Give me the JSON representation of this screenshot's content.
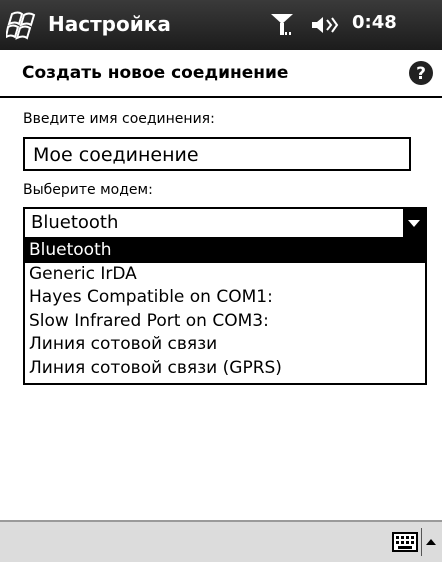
{
  "titlebar": {
    "app_title": "Настройка",
    "clock": "0:48",
    "icons": [
      "start-logo-icon",
      "signal-icon",
      "volume-icon"
    ]
  },
  "header": {
    "title": "Создать новое соединение",
    "help_icon": "help-icon"
  },
  "form": {
    "name_label": "Введите имя соединения:",
    "name_value": "Мое соединение",
    "modem_label": "Выберите модем:",
    "modem_selected": "Bluetooth",
    "modem_options": [
      "Bluetooth",
      "Generic IrDA",
      "Hayes Compatible on COM1:",
      "Slow Infrared Port on COM3:",
      "Линия сотовой связи",
      "Линия сотовой связи (GPRS)"
    ]
  },
  "menubar": {
    "icons": [
      "keyboard-icon",
      "sip-arrow-icon"
    ]
  },
  "colors": {
    "titlebar": "#2a2a2a",
    "highlight": "#000000",
    "menubar": "#dcdcdc"
  }
}
